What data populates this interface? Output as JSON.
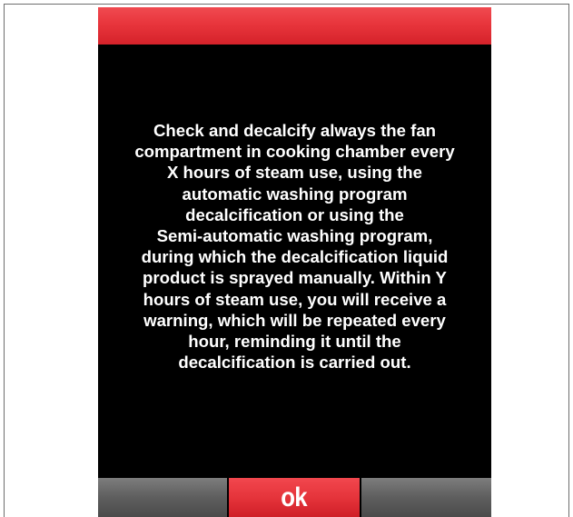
{
  "colors": {
    "header_red": "#e8353c",
    "screen_background": "#000000",
    "text": "#ffffff",
    "button_red": "#e5343b",
    "footer_gray": "#5e5e5e"
  },
  "message": {
    "lines": [
      "Check and decalcify always the fan",
      "compartment in cooking chamber every",
      "X hours of steam use, using the",
      "automatic washing program",
      "decalcification or  using the",
      "Semi-automatic washing program,",
      "during which the decalcification liquid",
      "product is sprayed manually. Within Y",
      "hours of steam use, you will receive a",
      "warning, which will be repeated every",
      "hour, reminding it until the",
      "decalcification is carried out."
    ]
  },
  "footer": {
    "ok_label": "ok"
  }
}
